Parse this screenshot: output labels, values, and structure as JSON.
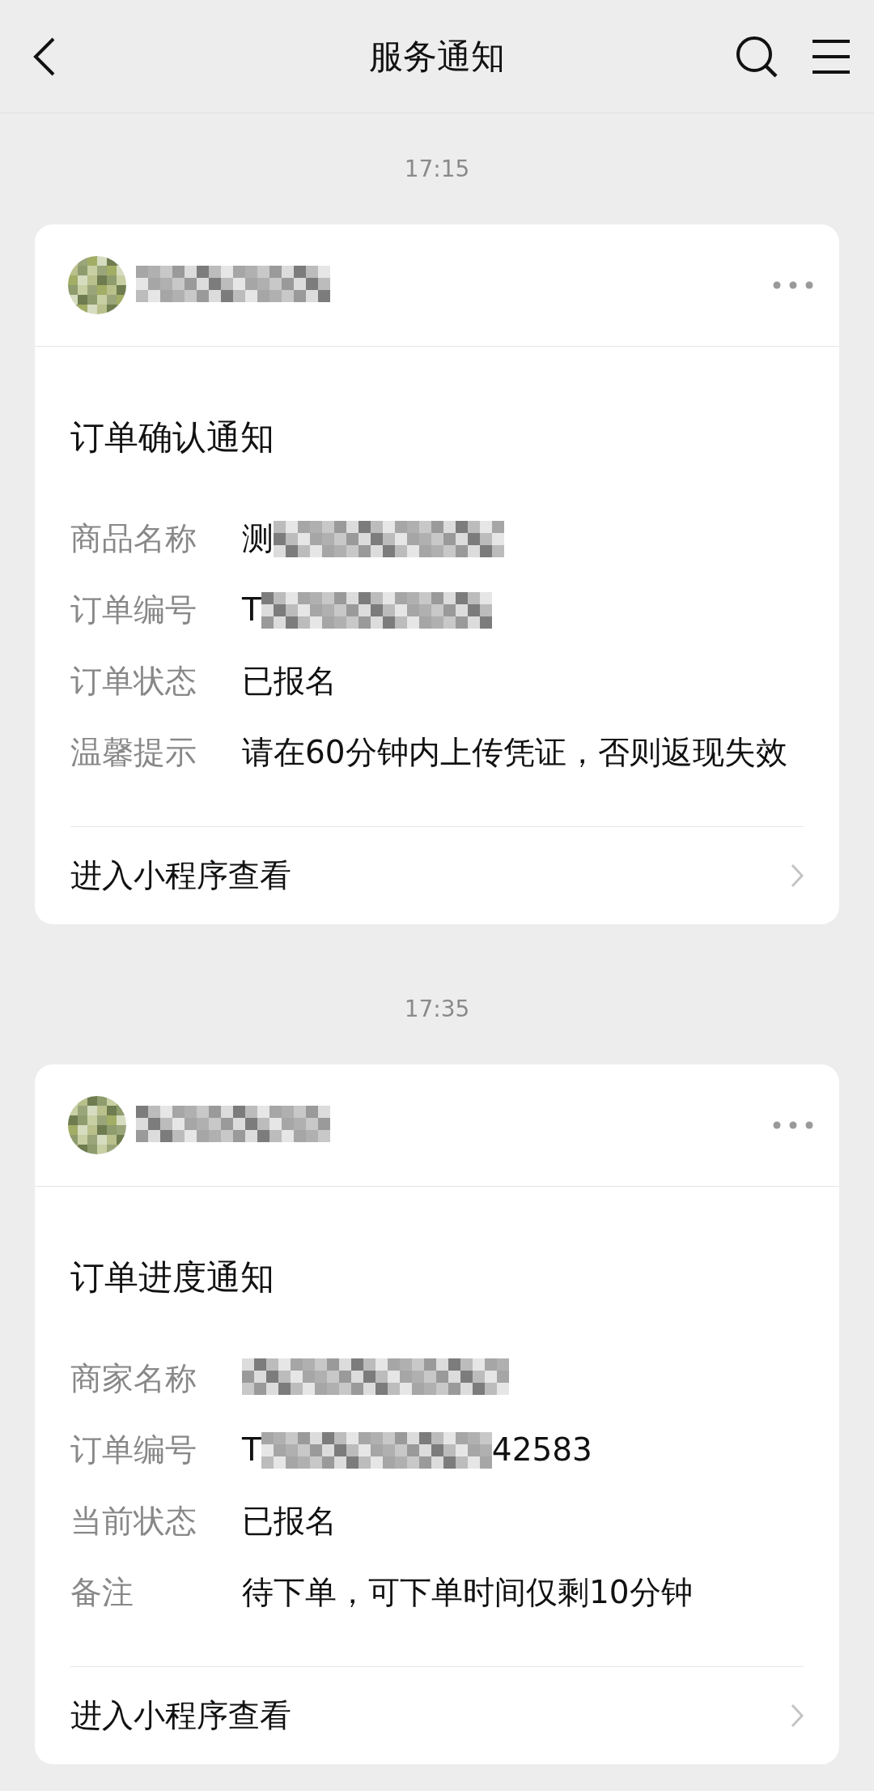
{
  "header": {
    "title": "服务通知"
  },
  "messages": [
    {
      "time": "17:15",
      "sender": {
        "kind": "redacted"
      },
      "title": "订单确认通知",
      "fields": [
        {
          "label": "商品名称",
          "value": [
            {
              "kind": "text",
              "text": "测"
            },
            {
              "kind": "redacted"
            }
          ]
        },
        {
          "label": "订单编号",
          "value": [
            {
              "kind": "text",
              "text": "T"
            },
            {
              "kind": "redacted"
            }
          ]
        },
        {
          "label": "订单状态",
          "value": [
            {
              "kind": "text",
              "text": "已报名"
            }
          ]
        },
        {
          "label": "温馨提示",
          "value": [
            {
              "kind": "text",
              "text": "请在60分钟内上传凭证，否则返现失效"
            }
          ]
        }
      ],
      "link": "进入小程序查看"
    },
    {
      "time": "17:35",
      "sender": {
        "kind": "redacted"
      },
      "title": "订单进度通知",
      "fields": [
        {
          "label": "商家名称",
          "value": [
            {
              "kind": "redacted"
            }
          ]
        },
        {
          "label": "订单编号",
          "value": [
            {
              "kind": "text",
              "text": "T"
            },
            {
              "kind": "redacted"
            },
            {
              "kind": "text",
              "text": "42583"
            }
          ]
        },
        {
          "label": "当前状态",
          "value": [
            {
              "kind": "text",
              "text": "已报名"
            }
          ]
        },
        {
          "label": "备注",
          "value": [
            {
              "kind": "text",
              "text": "待下单，可下单时间仅剩10分钟"
            }
          ]
        }
      ],
      "link": "进入小程序查看"
    }
  ]
}
